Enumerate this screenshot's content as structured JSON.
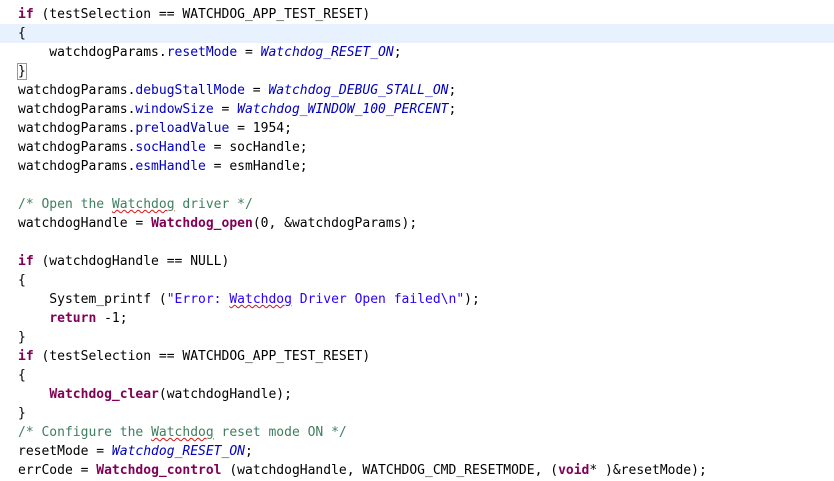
{
  "editor": {
    "language": "C",
    "highlighted_line": 2,
    "lines": [
      "if (testSelection == WATCHDOG_APP_TEST_RESET)",
      "{",
      "    watchdogParams.resetMode = Watchdog_RESET_ON;",
      "}",
      "watchdogParams.debugStallMode = Watchdog_DEBUG_STALL_ON;",
      "watchdogParams.windowSize = Watchdog_WINDOW_100_PERCENT;",
      "watchdogParams.preloadValue = 1954;",
      "watchdogParams.socHandle = socHandle;",
      "watchdogParams.esmHandle = esmHandle;",
      "",
      "/* Open the Watchdog driver */",
      "watchdogHandle = Watchdog_open(0, &watchdogParams);",
      "",
      "if (watchdogHandle == NULL)",
      "{",
      "    System_printf (\"Error: Watchdog Driver Open failed\\n\");",
      "    return -1;",
      "}",
      "if (testSelection == WATCHDOG_APP_TEST_RESET)",
      "{",
      "    Watchdog_clear(watchdogHandle);",
      "}",
      "/* Configure the Watchdog reset mode ON */",
      "resetMode = Watchdog_RESET_ON;",
      "errCode = Watchdog_control (watchdogHandle, WATCHDOG_CMD_RESETMODE, (void* )&resetMode);"
    ],
    "colors": {
      "keyword": "#7f0055",
      "field": "#0000c0",
      "enum_constant": "#0000c0",
      "string": "#2a00ff",
      "comment": "#3f7f5f",
      "current_line": "#e8f2fe"
    }
  }
}
